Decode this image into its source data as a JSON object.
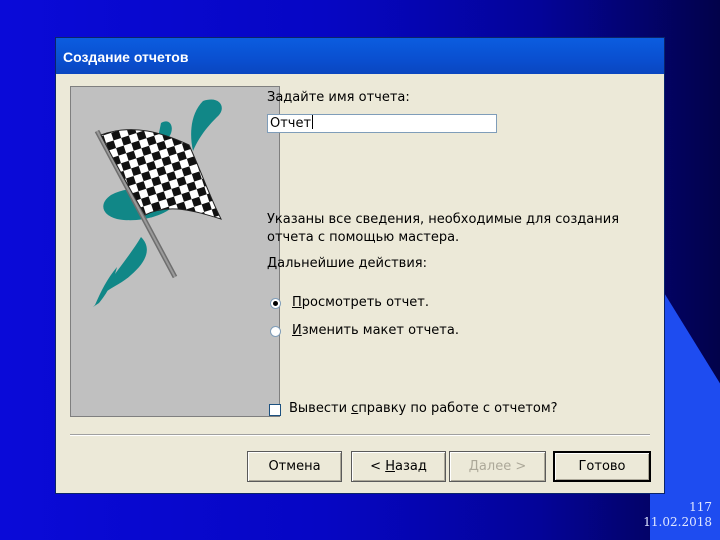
{
  "dialog": {
    "title": "Создание отчетов",
    "name_prompt": "Задайте имя отчета:",
    "name_value": "Отчет",
    "info_line1": "Указаны все сведения, необходимые для создания",
    "info_line2": "отчета с помощью мастера.",
    "next_actions": "Дальнейшие действия:",
    "options": [
      {
        "label_underlined": "П",
        "label_rest": "росмотреть отчет.",
        "selected": true
      },
      {
        "label_underlined": "И",
        "label_rest": "зменить макет отчета.",
        "selected": false
      }
    ],
    "help_checkbox": {
      "pre": "Вывести ",
      "underlined": "с",
      "post": "правку по работе с отчетом?",
      "checked": false
    },
    "buttons": {
      "cancel": "Отмена",
      "back_pre": "< ",
      "back_underlined": "Н",
      "back_post": "азад",
      "next": "Далее >",
      "finish": "Готово"
    }
  },
  "slide": {
    "page_number": "117",
    "date": "11.02.2018"
  },
  "colors": {
    "accent_teal": "#118787",
    "titlebar": "#0a55d6",
    "dialog_bg": "#ece9d8"
  },
  "icons": {
    "image": "checkered-flag-icon"
  }
}
